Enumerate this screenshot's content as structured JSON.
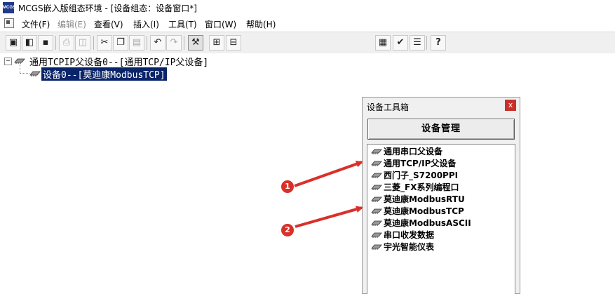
{
  "window": {
    "app_icon_text": "MCGS",
    "title": "MCGS嵌入版组态环境 - [设备组态：设备窗口*]"
  },
  "menu": {
    "items": [
      {
        "label": "文件(F)",
        "enabled": true
      },
      {
        "label": "编辑(E)",
        "enabled": false
      },
      {
        "label": "查看(V)",
        "enabled": true
      },
      {
        "label": "插入(I)",
        "enabled": true
      },
      {
        "label": "工具(T)",
        "enabled": true
      },
      {
        "label": "窗口(W)",
        "enabled": true
      },
      {
        "label": "帮助(H)",
        "enabled": true
      }
    ]
  },
  "toolbar": {
    "buttons": [
      {
        "icon": "new-window-icon",
        "glyph": "▣",
        "enabled": true
      },
      {
        "icon": "open-icon",
        "glyph": "◧",
        "enabled": true
      },
      {
        "icon": "save-icon",
        "glyph": "▪",
        "enabled": true
      },
      {
        "icon": "print-icon",
        "glyph": "⎙",
        "enabled": false
      },
      {
        "icon": "print-preview-icon",
        "glyph": "◫",
        "enabled": false
      },
      {
        "icon": "cut-icon",
        "glyph": "✂",
        "enabled": true
      },
      {
        "icon": "copy-icon",
        "glyph": "❐",
        "enabled": true
      },
      {
        "icon": "paste-icon",
        "glyph": "▤",
        "enabled": false
      },
      {
        "icon": "undo-icon",
        "glyph": "↶",
        "enabled": true
      },
      {
        "icon": "redo-icon",
        "glyph": "↷",
        "enabled": false
      },
      {
        "icon": "tools-icon",
        "glyph": "⚒",
        "enabled": true,
        "pressed": true
      },
      {
        "icon": "device-tree-icon",
        "glyph": "⊞",
        "enabled": true
      },
      {
        "icon": "device-tree-add-icon",
        "glyph": "⊟",
        "enabled": true
      },
      {
        "icon": "properties-icon",
        "glyph": "▦",
        "enabled": true
      },
      {
        "icon": "check-icon",
        "glyph": "✔",
        "enabled": true
      },
      {
        "icon": "list-icon",
        "glyph": "☰",
        "enabled": true
      },
      {
        "icon": "help-icon",
        "glyph": "?",
        "enabled": true
      }
    ]
  },
  "tree": {
    "root": {
      "expander": "−",
      "label": "通用TCPIP父设备0--[通用TCP/IP父设备]"
    },
    "child": {
      "label": "设备0--[莫迪康ModbusTCP]",
      "selected": true
    }
  },
  "toolbox": {
    "title": "设备工具箱",
    "close_label": "x",
    "manage_button": "设备管理",
    "items": [
      "通用串口父设备",
      "通用TCP/IP父设备",
      "西门子_S7200PPI",
      "三菱_FX系列编程口",
      "莫迪康ModbusRTU",
      "莫迪康ModbusTCP",
      "莫迪康ModbusASCII",
      "串口收发数据",
      "宇光智能仪表"
    ]
  },
  "annotations": [
    {
      "number": "1",
      "color": "#d9302a"
    },
    {
      "number": "2",
      "color": "#d9302a"
    }
  ],
  "colors": {
    "selection": "#0a246a",
    "annotation": "#d9302a",
    "chrome": "#f0f0f0"
  }
}
